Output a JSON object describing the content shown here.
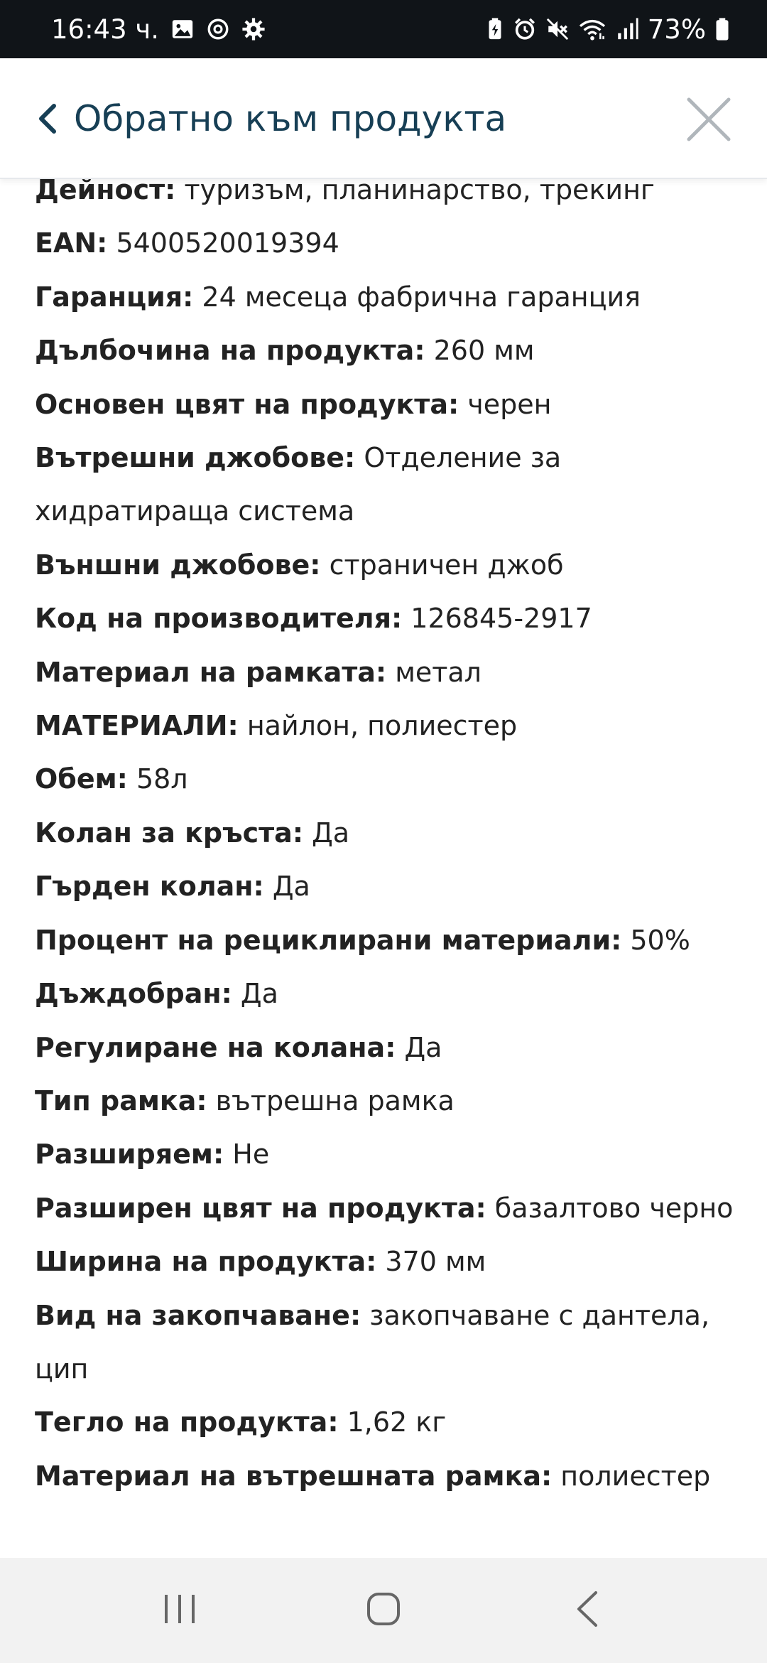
{
  "status_bar": {
    "time": "16:43 ч.",
    "battery": "73%",
    "left_icons": [
      "gallery-icon",
      "threads-icon",
      "settings-icon"
    ],
    "right_icons": [
      "battery-saver-icon",
      "alarm-icon",
      "mute-icon",
      "wifi-icon",
      "signal-icon",
      "battery-icon"
    ]
  },
  "header": {
    "back_label": "Обратно към продукта",
    "back_icon": "chevron-left-icon",
    "close_icon": "close-icon",
    "accent_color": "#173f55"
  },
  "specs": [
    {
      "label": "Дейност:",
      "value": " туризъм, планинарство, трекинг"
    },
    {
      "label": "EAN:",
      "value": " 5400520019394"
    },
    {
      "label": "Гаранция:",
      "value": " 24 месеца фабрична гаранция"
    },
    {
      "label": "Дълбочина на продукта:",
      "value": " 260 мм"
    },
    {
      "label": "Основен цвят на продукта:",
      "value": " черен"
    },
    {
      "label": "Вътрешни джобове:",
      "value": " Отделение за хидратираща система"
    },
    {
      "label": "Външни джобове:",
      "value": " страничен джоб"
    },
    {
      "label": "Код на производителя:",
      "value": " 126845-2917"
    },
    {
      "label": "Материал на рамката:",
      "value": " метал"
    },
    {
      "label": "МАТЕРИАЛИ:",
      "value": " найлон, полиестер"
    },
    {
      "label": "Обем:",
      "value": " 58л"
    },
    {
      "label": "Колан за кръста:",
      "value": " Да"
    },
    {
      "label": "Гърден колан:",
      "value": " Да"
    },
    {
      "label": "Процент на рециклирани материали:",
      "value": " 50%"
    },
    {
      "label": "Дъждобран:",
      "value": " Да"
    },
    {
      "label": "Регулиране на колана:",
      "value": " Да"
    },
    {
      "label": "Тип рамка:",
      "value": " вътрешна рамка"
    },
    {
      "label": "Разширяем:",
      "value": " Не"
    },
    {
      "label": "Разширен цвят на продукта:",
      "value": " базалтово черно"
    },
    {
      "label": "Ширина на продукта:",
      "value": " 370 мм"
    },
    {
      "label": "Вид на закопчаване:",
      "value": " закопчаване с дантела, цип"
    },
    {
      "label": "Тегло на продукта:",
      "value": " 1,62 кг"
    },
    {
      "label": "Материал на вътрешната рамка:",
      "value": " полиестер"
    }
  ],
  "nav_bar": {
    "icons": [
      "recent-apps-icon",
      "home-icon",
      "back-icon"
    ]
  }
}
